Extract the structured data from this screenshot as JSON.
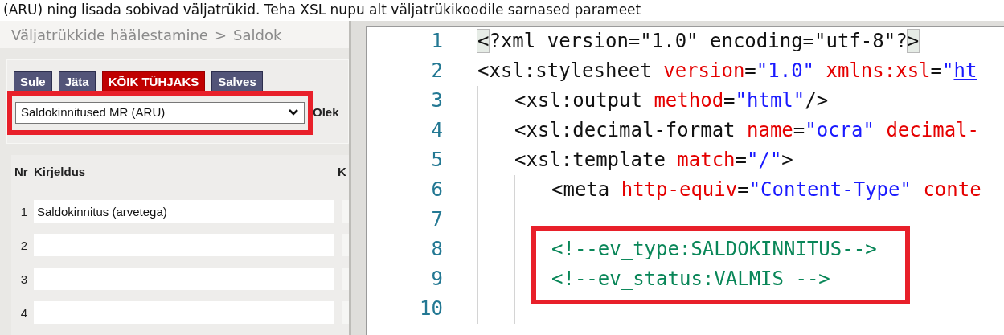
{
  "intro_text": "(ARU) ning lisada sobivad väljatrükid. Teha XSL nupu alt väljatrükikoodile sarnased parameet",
  "left_panel": {
    "breadcrumb": [
      "Väljatrükkide häälestamine",
      "Saldok"
    ],
    "breadcrumb_separator": ">",
    "buttons": [
      {
        "label": "Sule",
        "kind": "default"
      },
      {
        "label": "Jäta",
        "kind": "default"
      },
      {
        "label": "KÕIK TÜHJAKS",
        "kind": "danger"
      },
      {
        "label": "Salves",
        "kind": "default"
      }
    ],
    "select": {
      "value": "Saldokinnitused MR (ARU)",
      "highlighted": true
    },
    "status_label": "Olek",
    "table": {
      "columns": [
        "Nr",
        "Kirjeldus",
        "K"
      ],
      "rows": [
        {
          "nr": "1",
          "kirjeldus": "Saldokinnitus (arvetega)"
        },
        {
          "nr": "2"
        },
        {
          "nr": "3"
        },
        {
          "nr": "4"
        }
      ]
    }
  },
  "editor": {
    "lines": [
      {
        "number": "1",
        "tokens": [
          {
            "text": "<",
            "kind": "bracket"
          },
          {
            "text": "?xml version=\"1.0\" encoding=\"utf-8\"?",
            "kind": "plain"
          },
          {
            "text": ">",
            "kind": "bracket"
          }
        ]
      },
      {
        "number": "2",
        "tokens": [
          {
            "text": "<xsl:stylesheet ",
            "kind": "plain"
          },
          {
            "text": "version",
            "kind": "attr"
          },
          {
            "text": "=",
            "kind": "plain"
          },
          {
            "text": "\"1.0\" ",
            "kind": "value"
          },
          {
            "text": "xmlns:xsl",
            "kind": "attr"
          },
          {
            "text": "=",
            "kind": "plain"
          },
          {
            "text": "\"",
            "kind": "value"
          },
          {
            "text": "ht",
            "kind": "link"
          }
        ],
        "children": [
          {
            "number": "3",
            "tokens": [
              {
                "text": "<xsl:output ",
                "kind": "plain"
              },
              {
                "text": "method",
                "kind": "attr"
              },
              {
                "text": "=",
                "kind": "plain"
              },
              {
                "text": "\"html\"",
                "kind": "value"
              },
              {
                "text": "/>",
                "kind": "plain"
              }
            ]
          },
          {
            "number": "4",
            "tokens": [
              {
                "text": "<xsl:decimal-format ",
                "kind": "plain"
              },
              {
                "text": "name",
                "kind": "attr"
              },
              {
                "text": "=",
                "kind": "plain"
              },
              {
                "text": "\"ocra\" ",
                "kind": "value"
              },
              {
                "text": "decimal-",
                "kind": "attr"
              }
            ]
          },
          {
            "number": "5",
            "tokens": [
              {
                "text": "<xsl:template ",
                "kind": "plain"
              },
              {
                "text": "match",
                "kind": "attr"
              },
              {
                "text": "=",
                "kind": "plain"
              },
              {
                "text": "\"/\"",
                "kind": "value"
              },
              {
                "text": ">",
                "kind": "plain"
              }
            ],
            "children": [
              {
                "number": "6",
                "tokens": [
                  {
                    "text": "<meta ",
                    "kind": "plain"
                  },
                  {
                    "text": "http-equiv",
                    "kind": "attr"
                  },
                  {
                    "text": "=",
                    "kind": "plain"
                  },
                  {
                    "text": "\"Content-Type\" ",
                    "kind": "value"
                  },
                  {
                    "text": "conte",
                    "kind": "attr"
                  }
                ]
              },
              {
                "number": "7"
              },
              {
                "number": "8",
                "highlighted": true,
                "tokens": [
                  {
                    "text": "<!--ev_type:SALDOKINNITUS-->",
                    "kind": "comment"
                  }
                ]
              },
              {
                "number": "9",
                "highlighted": true,
                "tokens": [
                  {
                    "text": "<!--ev_status:VALMIS -->",
                    "kind": "comment"
                  }
                ]
              },
              {
                "number": "10"
              }
            ]
          }
        ]
      }
    ]
  }
}
